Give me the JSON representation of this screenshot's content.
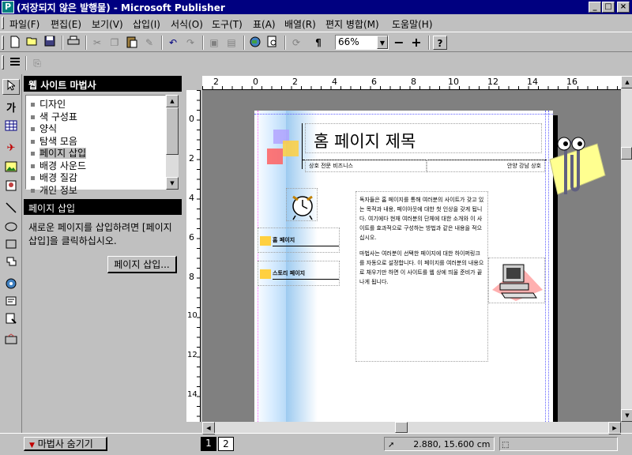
{
  "window": {
    "title": "(저장되지 않은 발행물) - Microsoft Publisher",
    "controls": {
      "minimize": "_",
      "maximize": "□",
      "close": "×"
    }
  },
  "menu": {
    "items": [
      "파일(F)",
      "편집(E)",
      "보기(V)",
      "삽입(I)",
      "서식(O)",
      "도구(T)",
      "표(A)",
      "배열(R)",
      "편지 병합(M)",
      "도움말(H)"
    ]
  },
  "toolbar": {
    "zoom": "66%",
    "zoom_out": "−",
    "zoom_in": "+",
    "help": "?"
  },
  "wizard": {
    "title": "웹 사이트 마법사",
    "options": [
      "디자인",
      "색 구성표",
      "양식",
      "탐색 모음",
      "페이지 삽입",
      "배경 사운드",
      "배경 질감",
      "개인 정보"
    ],
    "selected_index": 4,
    "section_title": "페이지 삽입",
    "description": "새로운 페이지를 삽입하려면 [페이지 삽입]을 클릭하십시오.",
    "insert_button": "페이지 삽입...",
    "hide_button": "마법사 숨기기"
  },
  "ruler": {
    "top_labels": [
      "2",
      "0",
      "2",
      "4",
      "6",
      "8",
      "10",
      "12",
      "14",
      "16"
    ],
    "left_labels": [
      "0",
      "2",
      "4",
      "6",
      "8",
      "10",
      "12",
      "14"
    ]
  },
  "page": {
    "title": "홈 페이지 제목",
    "subtitle_left": "상호 전문 비즈니스",
    "subtitle_right": "안양 강남 상호",
    "nav_items": [
      "홈 페이지",
      "스토리 페이지"
    ],
    "body_para1": "독자들은 홈 페이지를 통해 여러분의 사이트가 갖고 있는 목적과 내용, 페이아웃에 대한 첫 인상을 갖게 됩니다. 여기에다 현재 여러분의 단체에 대한 소개와 이 사이트를 효과적으로 구성하는 방법과 같은 내용을 적으십시오.",
    "body_para2": "마법사는 여러분이 선택한 페이지에 대한 하이퍼링크를 자동으로 설정합니다. 이 페이지를 여러분의 내용으로 채우기만 하면 이 사이트를 웹 상에 띄울 준비가 끝나게 됩니다."
  },
  "status": {
    "pages": [
      "1",
      "2"
    ],
    "position": "2.880, 15.600 cm"
  },
  "colors": {
    "titlebar": "#000080",
    "chrome": "#c0c0c0",
    "workspace": "#808080",
    "guide": "#6060ff"
  }
}
